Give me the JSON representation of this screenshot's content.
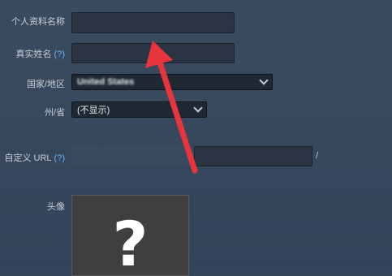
{
  "form": {
    "profile_name": {
      "label": "个人资料名称",
      "value": ""
    },
    "real_name": {
      "label": "真实姓名",
      "help": "(?)",
      "value": ""
    },
    "country": {
      "label": "国家/地区",
      "value": "United States"
    },
    "state": {
      "label": "州/省",
      "value": "(不显示)"
    },
    "custom_url": {
      "label": "自定义 URL",
      "help": "(?)",
      "value": "",
      "suffix": "/"
    },
    "avatar": {
      "label": "头像",
      "placeholder_glyph": "?"
    }
  },
  "colors": {
    "background": "#36465a",
    "help_link": "#66b3ff",
    "arrow": "#e8343c"
  }
}
